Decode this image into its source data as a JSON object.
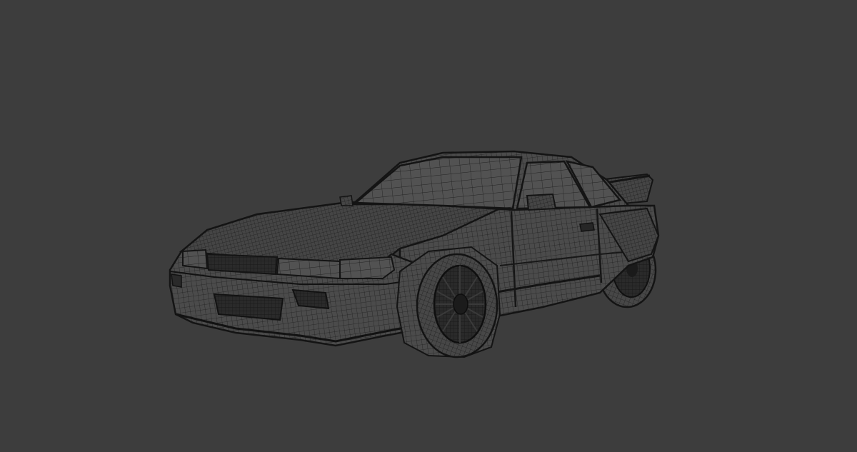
{
  "viewport": {
    "background_color": "#3d3d3d",
    "subject": "wireframe-sports-car",
    "render_mode": "wireframe",
    "wire_color": "#1c1c1c",
    "shell_color": "#4a4a4a"
  }
}
